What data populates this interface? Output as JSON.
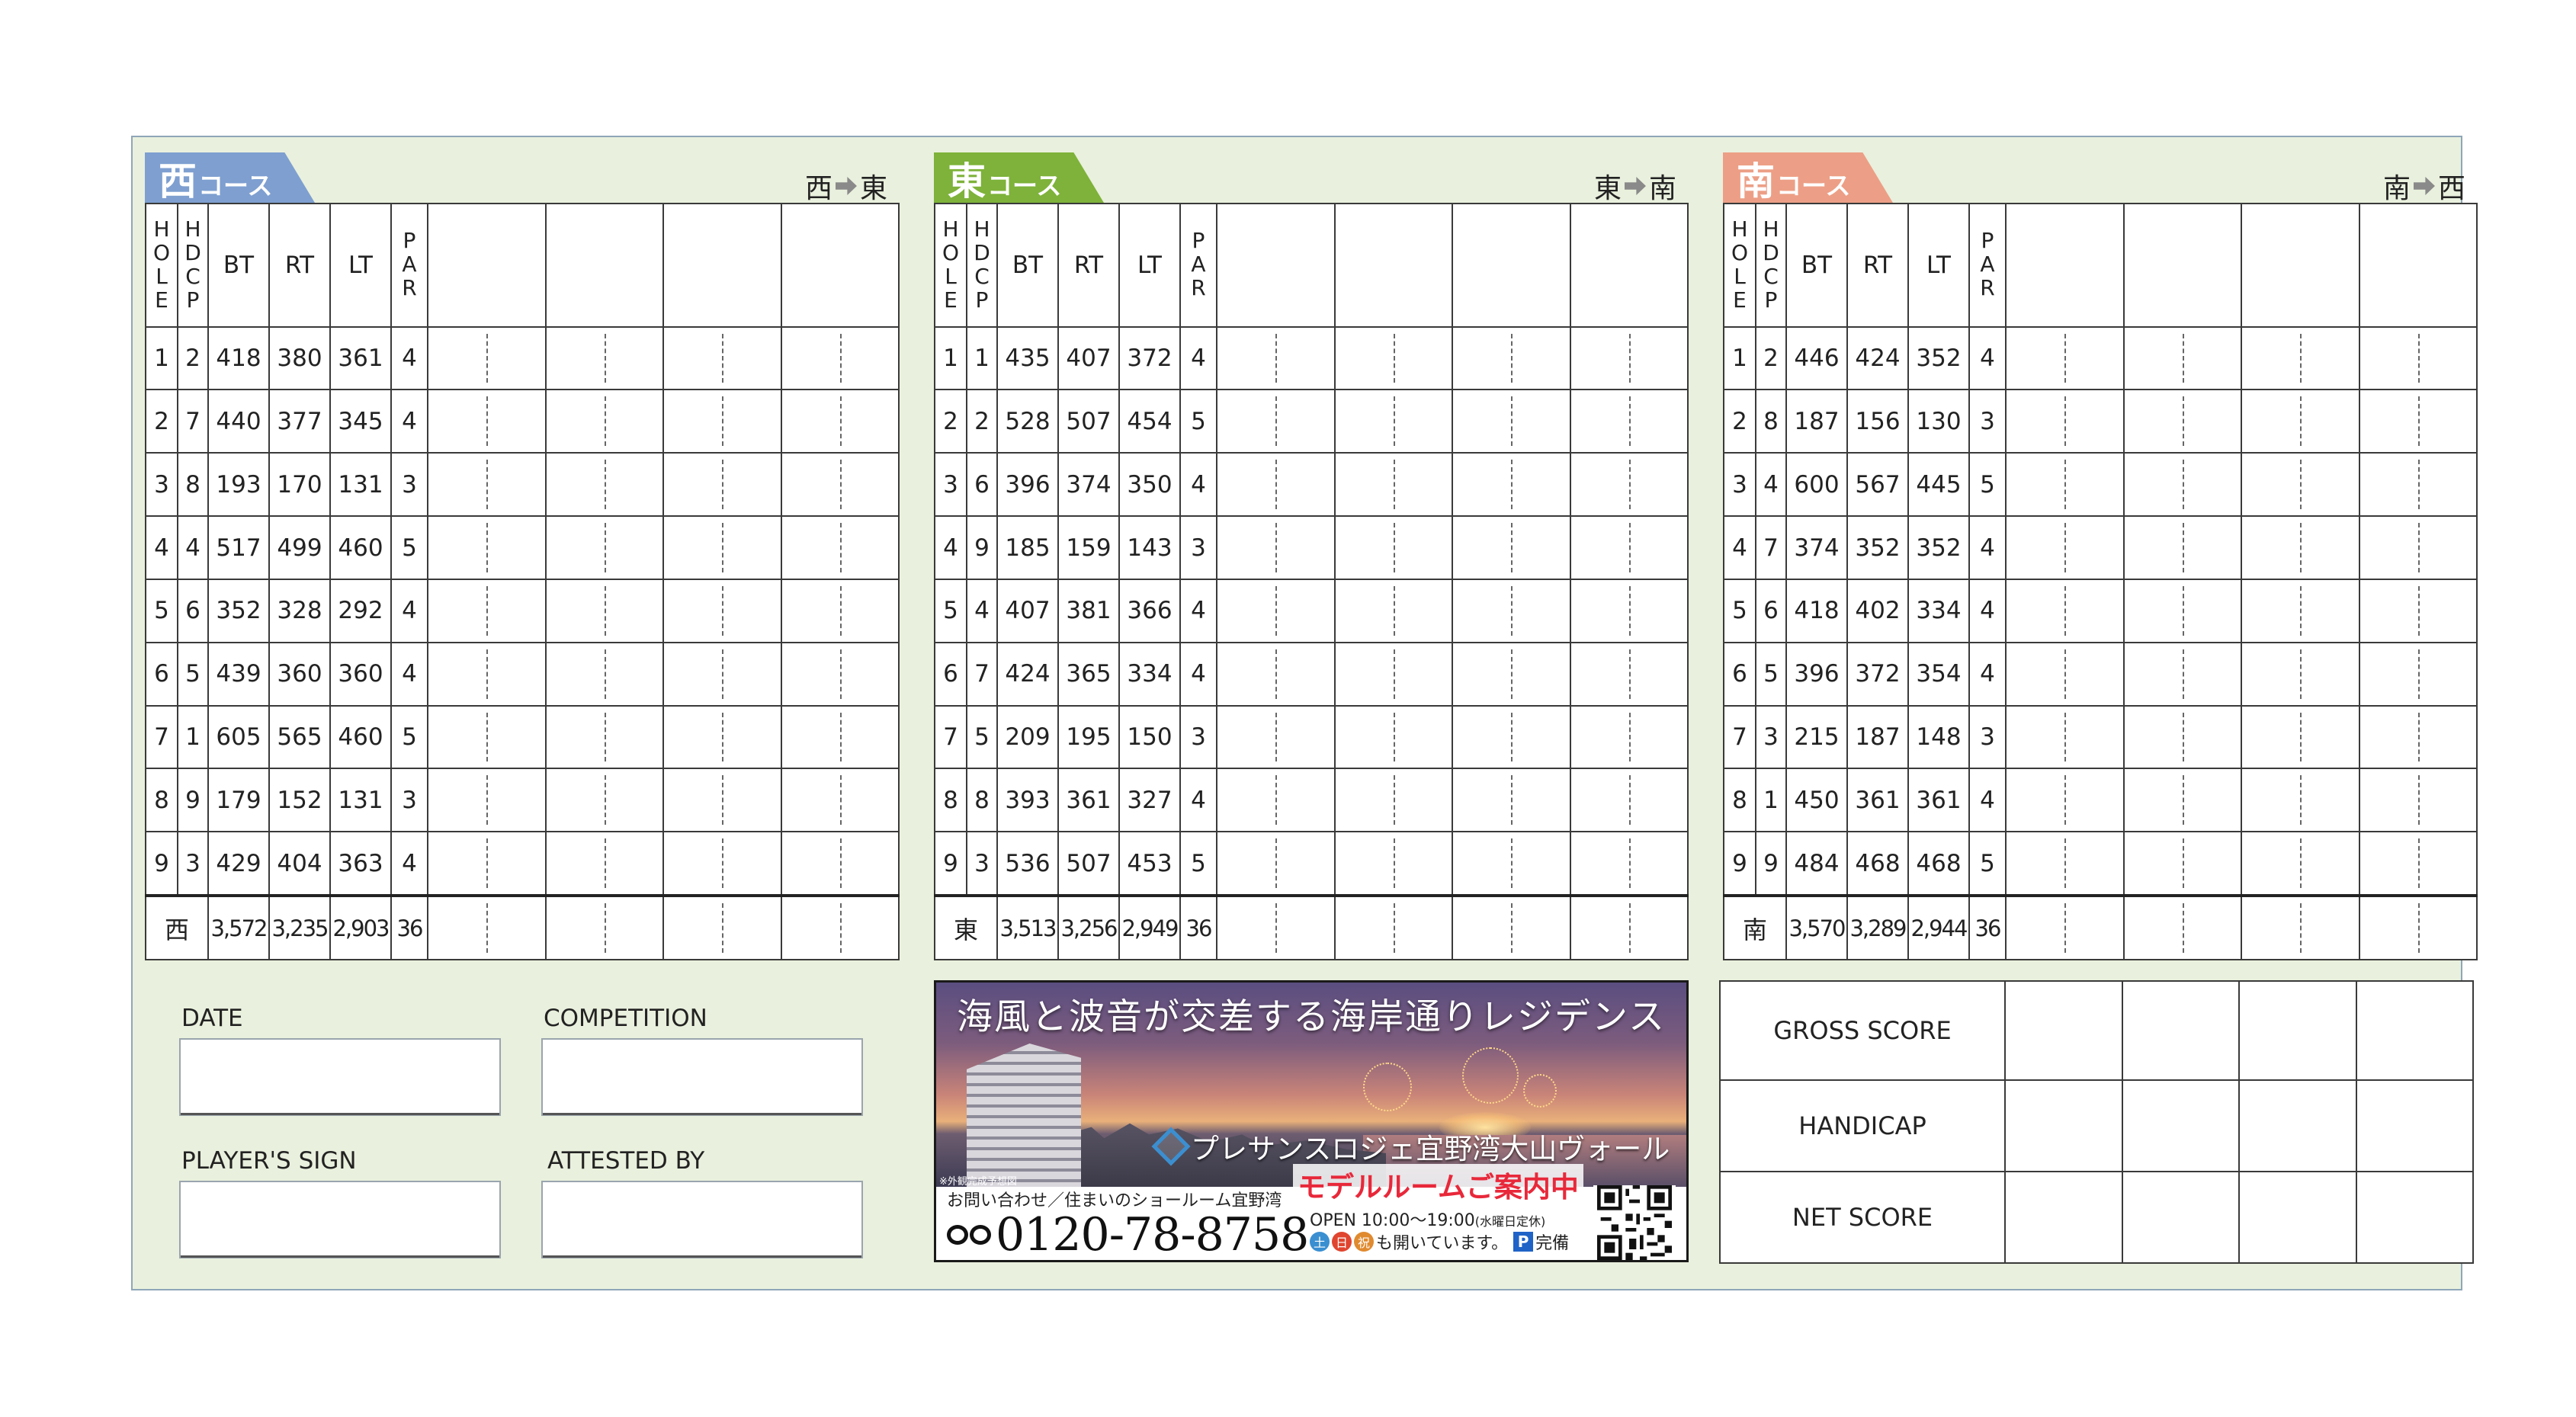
{
  "courses": [
    {
      "key": "west",
      "name_char": "西",
      "name_suffix": "コース",
      "color": "#7e9fd0",
      "dir_from": "西",
      "dir_to": "東",
      "holes": [
        {
          "hole": "1",
          "hdcp": "2",
          "bt": "418",
          "rt": "380",
          "lt": "361",
          "par": "4"
        },
        {
          "hole": "2",
          "hdcp": "7",
          "bt": "440",
          "rt": "377",
          "lt": "345",
          "par": "4"
        },
        {
          "hole": "3",
          "hdcp": "8",
          "bt": "193",
          "rt": "170",
          "lt": "131",
          "par": "3"
        },
        {
          "hole": "4",
          "hdcp": "4",
          "bt": "517",
          "rt": "499",
          "lt": "460",
          "par": "5"
        },
        {
          "hole": "5",
          "hdcp": "6",
          "bt": "352",
          "rt": "328",
          "lt": "292",
          "par": "4"
        },
        {
          "hole": "6",
          "hdcp": "5",
          "bt": "439",
          "rt": "360",
          "lt": "360",
          "par": "4"
        },
        {
          "hole": "7",
          "hdcp": "1",
          "bt": "605",
          "rt": "565",
          "lt": "460",
          "par": "5"
        },
        {
          "hole": "8",
          "hdcp": "9",
          "bt": "179",
          "rt": "152",
          "lt": "131",
          "par": "3"
        },
        {
          "hole": "9",
          "hdcp": "3",
          "bt": "429",
          "rt": "404",
          "lt": "363",
          "par": "4"
        }
      ],
      "total": {
        "name": "西",
        "bt": "3,572",
        "rt": "3,235",
        "lt": "2,903",
        "par": "36"
      }
    },
    {
      "key": "east",
      "name_char": "東",
      "name_suffix": "コース",
      "color": "#7eb23a",
      "dir_from": "東",
      "dir_to": "南",
      "holes": [
        {
          "hole": "1",
          "hdcp": "1",
          "bt": "435",
          "rt": "407",
          "lt": "372",
          "par": "4"
        },
        {
          "hole": "2",
          "hdcp": "2",
          "bt": "528",
          "rt": "507",
          "lt": "454",
          "par": "5"
        },
        {
          "hole": "3",
          "hdcp": "6",
          "bt": "396",
          "rt": "374",
          "lt": "350",
          "par": "4"
        },
        {
          "hole": "4",
          "hdcp": "9",
          "bt": "185",
          "rt": "159",
          "lt": "143",
          "par": "3"
        },
        {
          "hole": "5",
          "hdcp": "4",
          "bt": "407",
          "rt": "381",
          "lt": "366",
          "par": "4"
        },
        {
          "hole": "6",
          "hdcp": "7",
          "bt": "424",
          "rt": "365",
          "lt": "334",
          "par": "4"
        },
        {
          "hole": "7",
          "hdcp": "5",
          "bt": "209",
          "rt": "195",
          "lt": "150",
          "par": "3"
        },
        {
          "hole": "8",
          "hdcp": "8",
          "bt": "393",
          "rt": "361",
          "lt": "327",
          "par": "4"
        },
        {
          "hole": "9",
          "hdcp": "3",
          "bt": "536",
          "rt": "507",
          "lt": "453",
          "par": "5"
        }
      ],
      "total": {
        "name": "東",
        "bt": "3,513",
        "rt": "3,256",
        "lt": "2,949",
        "par": "36"
      }
    },
    {
      "key": "south",
      "name_char": "南",
      "name_suffix": "コース",
      "color": "#ec9f86",
      "dir_from": "南",
      "dir_to": "西",
      "holes": [
        {
          "hole": "1",
          "hdcp": "2",
          "bt": "446",
          "rt": "424",
          "lt": "352",
          "par": "4"
        },
        {
          "hole": "2",
          "hdcp": "8",
          "bt": "187",
          "rt": "156",
          "lt": "130",
          "par": "3"
        },
        {
          "hole": "3",
          "hdcp": "4",
          "bt": "600",
          "rt": "567",
          "lt": "445",
          "par": "5"
        },
        {
          "hole": "4",
          "hdcp": "7",
          "bt": "374",
          "rt": "352",
          "lt": "352",
          "par": "4"
        },
        {
          "hole": "5",
          "hdcp": "6",
          "bt": "418",
          "rt": "402",
          "lt": "334",
          "par": "4"
        },
        {
          "hole": "6",
          "hdcp": "5",
          "bt": "396",
          "rt": "372",
          "lt": "354",
          "par": "4"
        },
        {
          "hole": "7",
          "hdcp": "3",
          "bt": "215",
          "rt": "187",
          "lt": "148",
          "par": "3"
        },
        {
          "hole": "8",
          "hdcp": "1",
          "bt": "450",
          "rt": "361",
          "lt": "361",
          "par": "4"
        },
        {
          "hole": "9",
          "hdcp": "9",
          "bt": "484",
          "rt": "468",
          "lt": "468",
          "par": "5"
        }
      ],
      "total": {
        "name": "南",
        "bt": "3,570",
        "rt": "3,289",
        "lt": "2,944",
        "par": "36"
      }
    }
  ],
  "headers": {
    "hole": [
      "H",
      "O",
      "L",
      "E"
    ],
    "hdcp": [
      "H",
      "D",
      "C",
      "P"
    ],
    "bt": "BT",
    "rt": "RT",
    "lt": "LT",
    "par": [
      "P",
      "A",
      "R"
    ]
  },
  "fields": {
    "date": "DATE",
    "competition": "COMPETITION",
    "player_sign": "PLAYER'S SIGN",
    "attested_by": "ATTESTED BY"
  },
  "ad": {
    "headline": "海風と波音が交差する海岸通りレジデンス",
    "logo": "プレサンスロジェ宜野湾大山ヴォール",
    "model_room": "モデルルームご案内中",
    "note": "※外観完成予想図",
    "contact": "お問い合わせ／住まいのショールーム宜野湾",
    "phone": "0120-78-8758",
    "hours": "OPEN 10:00～19:00",
    "closed": "(水曜日定休)",
    "day_sat": "土",
    "day_sun": "日",
    "day_hol": "祝",
    "open_text": "も開いています。",
    "parking_p": "P",
    "parking_text": "完備",
    "colors": {
      "sat": "#3a8fd1",
      "sun": "#e0452f",
      "hol": "#e08a2f"
    }
  },
  "summary": {
    "gross": "GROSS SCORE",
    "handicap": "HANDICAP",
    "net": "NET SCORE"
  }
}
